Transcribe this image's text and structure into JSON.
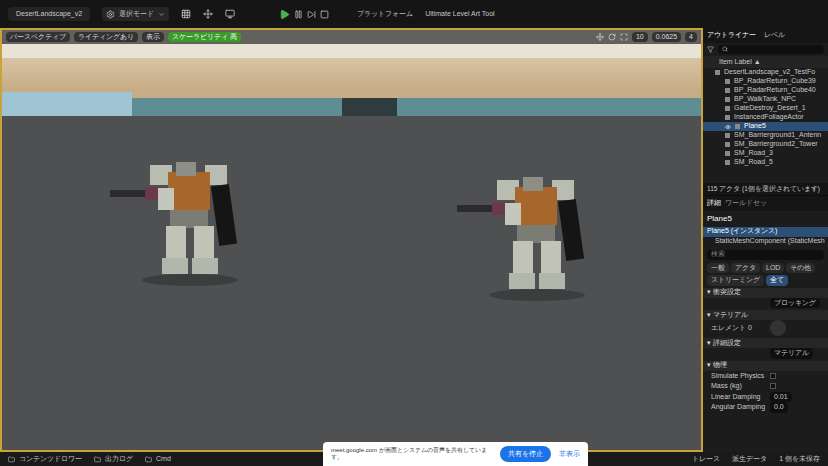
{
  "title_bar": {
    "file": "DesertLandscape_v2",
    "mode": "選択モード",
    "platform": "プラットフォーム",
    "tool": "Ultimate Level Art Tool"
  },
  "viewport": {
    "toolbar_left": [
      {
        "label": "パースペクティブ",
        "selected": false
      },
      {
        "label": "ライティングあり",
        "selected": false
      },
      {
        "label": "表示",
        "selected": false
      },
      {
        "label": "スケーラビリティ 高",
        "selected": true
      }
    ],
    "toolbar_right": [
      "10",
      "0.0625",
      "4"
    ]
  },
  "outliner": {
    "title": "アウトライナー",
    "tab": "レベル",
    "column": "Item Label ▲",
    "rows": [
      {
        "label": "DesertLandscape_v2_TestFo",
        "selected": false,
        "level": 0
      },
      {
        "label": "BP_RadarReturn_Cube39",
        "selected": false,
        "level": 1
      },
      {
        "label": "BP_RadarReturn_Cube40",
        "selected": false,
        "level": 1
      },
      {
        "label": "BP_WalkTank_NPC",
        "selected": false,
        "level": 1
      },
      {
        "label": "GateDestroy_Desert_1",
        "selected": false,
        "level": 1
      },
      {
        "label": "InstancedFoliageActor",
        "selected": false,
        "level": 1
      },
      {
        "label": "Plane5",
        "selected": true,
        "level": 1
      },
      {
        "label": "SM_Barrierground1_Antenn",
        "selected": false,
        "level": 1
      },
      {
        "label": "SM_Barrierground2_Tower",
        "selected": false,
        "level": 1
      },
      {
        "label": "SM_Road_3",
        "selected": false,
        "level": 1
      },
      {
        "label": "SM_Road_5",
        "selected": false,
        "level": 1
      }
    ],
    "footer": "115 アクタ (1個を選択されています)"
  },
  "details": {
    "tabs": [
      {
        "label": "詳細",
        "selected": true
      },
      {
        "label": "ワールドセッ",
        "selected": false
      }
    ],
    "object": "Plane5",
    "components": [
      {
        "label": "Plane5 (インスタンス)",
        "selected": true
      },
      {
        "label": "StaticMeshComponent (StaticMesh",
        "selected": false
      }
    ],
    "search": "検索",
    "filters": [
      {
        "label": "一般",
        "selected": false
      },
      {
        "label": "アクタ",
        "selected": false
      },
      {
        "label": "LOD",
        "selected": false
      },
      {
        "label": "その他",
        "selected": false
      },
      {
        "label": "ストリーミング",
        "selected": false
      },
      {
        "label": "全て",
        "selected": true
      }
    ],
    "sections": [
      {
        "title": "衝突設定",
        "rows": [
          {
            "label": "",
            "value": "ブロッキング",
            "kind": "value"
          }
        ]
      },
      {
        "title": "マテリアル",
        "rows": [
          {
            "label": "エレメント 0",
            "value": "",
            "kind": "material"
          }
        ]
      },
      {
        "title": "詳細設定",
        "rows": [
          {
            "label": "",
            "value": "マテリアル",
            "kind": "value"
          }
        ]
      },
      {
        "title": "物理",
        "rows": [
          {
            "label": "Simulate Physics",
            "value": "",
            "kind": "checkbox"
          },
          {
            "label": "Mass (kg)",
            "value": "",
            "kind": "checkbox"
          },
          {
            "label": "Linear Damping",
            "value": "0.01",
            "kind": "value"
          },
          {
            "label": "Angular Damping",
            "value": "0.0",
            "kind": "value"
          }
        ]
      }
    ]
  },
  "bottom_bar": {
    "left": [
      "コンテンツドロワー",
      "出力ログ",
      "Cmd"
    ],
    "right": [
      "トレース",
      "派生データ",
      "1 個を未保存"
    ]
  },
  "share_notice": {
    "message": "meet.google.com が画面とシステムの音声を共有しています。",
    "stop": "共有を停止",
    "hide": "非表示"
  }
}
